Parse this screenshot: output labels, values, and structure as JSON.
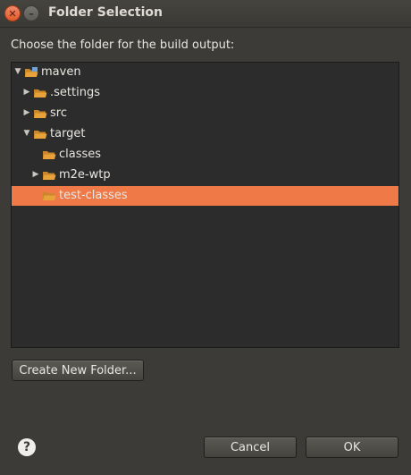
{
  "window": {
    "title": "Folder Selection",
    "close_glyph": "✕",
    "minimize_glyph": "–"
  },
  "prompt": "Choose the folder for the build output:",
  "tree": [
    {
      "label": "maven",
      "level": 0,
      "expander": "expanded",
      "icon": "project-folder-icon",
      "selected": false
    },
    {
      "label": ".settings",
      "level": 1,
      "expander": "collapsed",
      "icon": "folder-icon",
      "selected": false
    },
    {
      "label": "src",
      "level": 1,
      "expander": "collapsed",
      "icon": "folder-icon",
      "selected": false
    },
    {
      "label": "target",
      "level": 1,
      "expander": "expanded",
      "icon": "folder-icon",
      "selected": false
    },
    {
      "label": "classes",
      "level": 2,
      "expander": "none",
      "icon": "folder-icon",
      "selected": false
    },
    {
      "label": "m2e-wtp",
      "level": 2,
      "expander": "collapsed",
      "icon": "folder-icon",
      "selected": false
    },
    {
      "label": "test-classes",
      "level": 2,
      "expander": "none",
      "icon": "folder-icon",
      "selected": true
    }
  ],
  "buttons": {
    "create_new_folder": "Create New Folder...",
    "cancel": "Cancel",
    "ok": "OK",
    "help_glyph": "?"
  },
  "colors": {
    "selection": "#ef7a47",
    "folder": "#e7a33a",
    "background": "#3c3b37",
    "tree_background": "#2c2c2c"
  }
}
